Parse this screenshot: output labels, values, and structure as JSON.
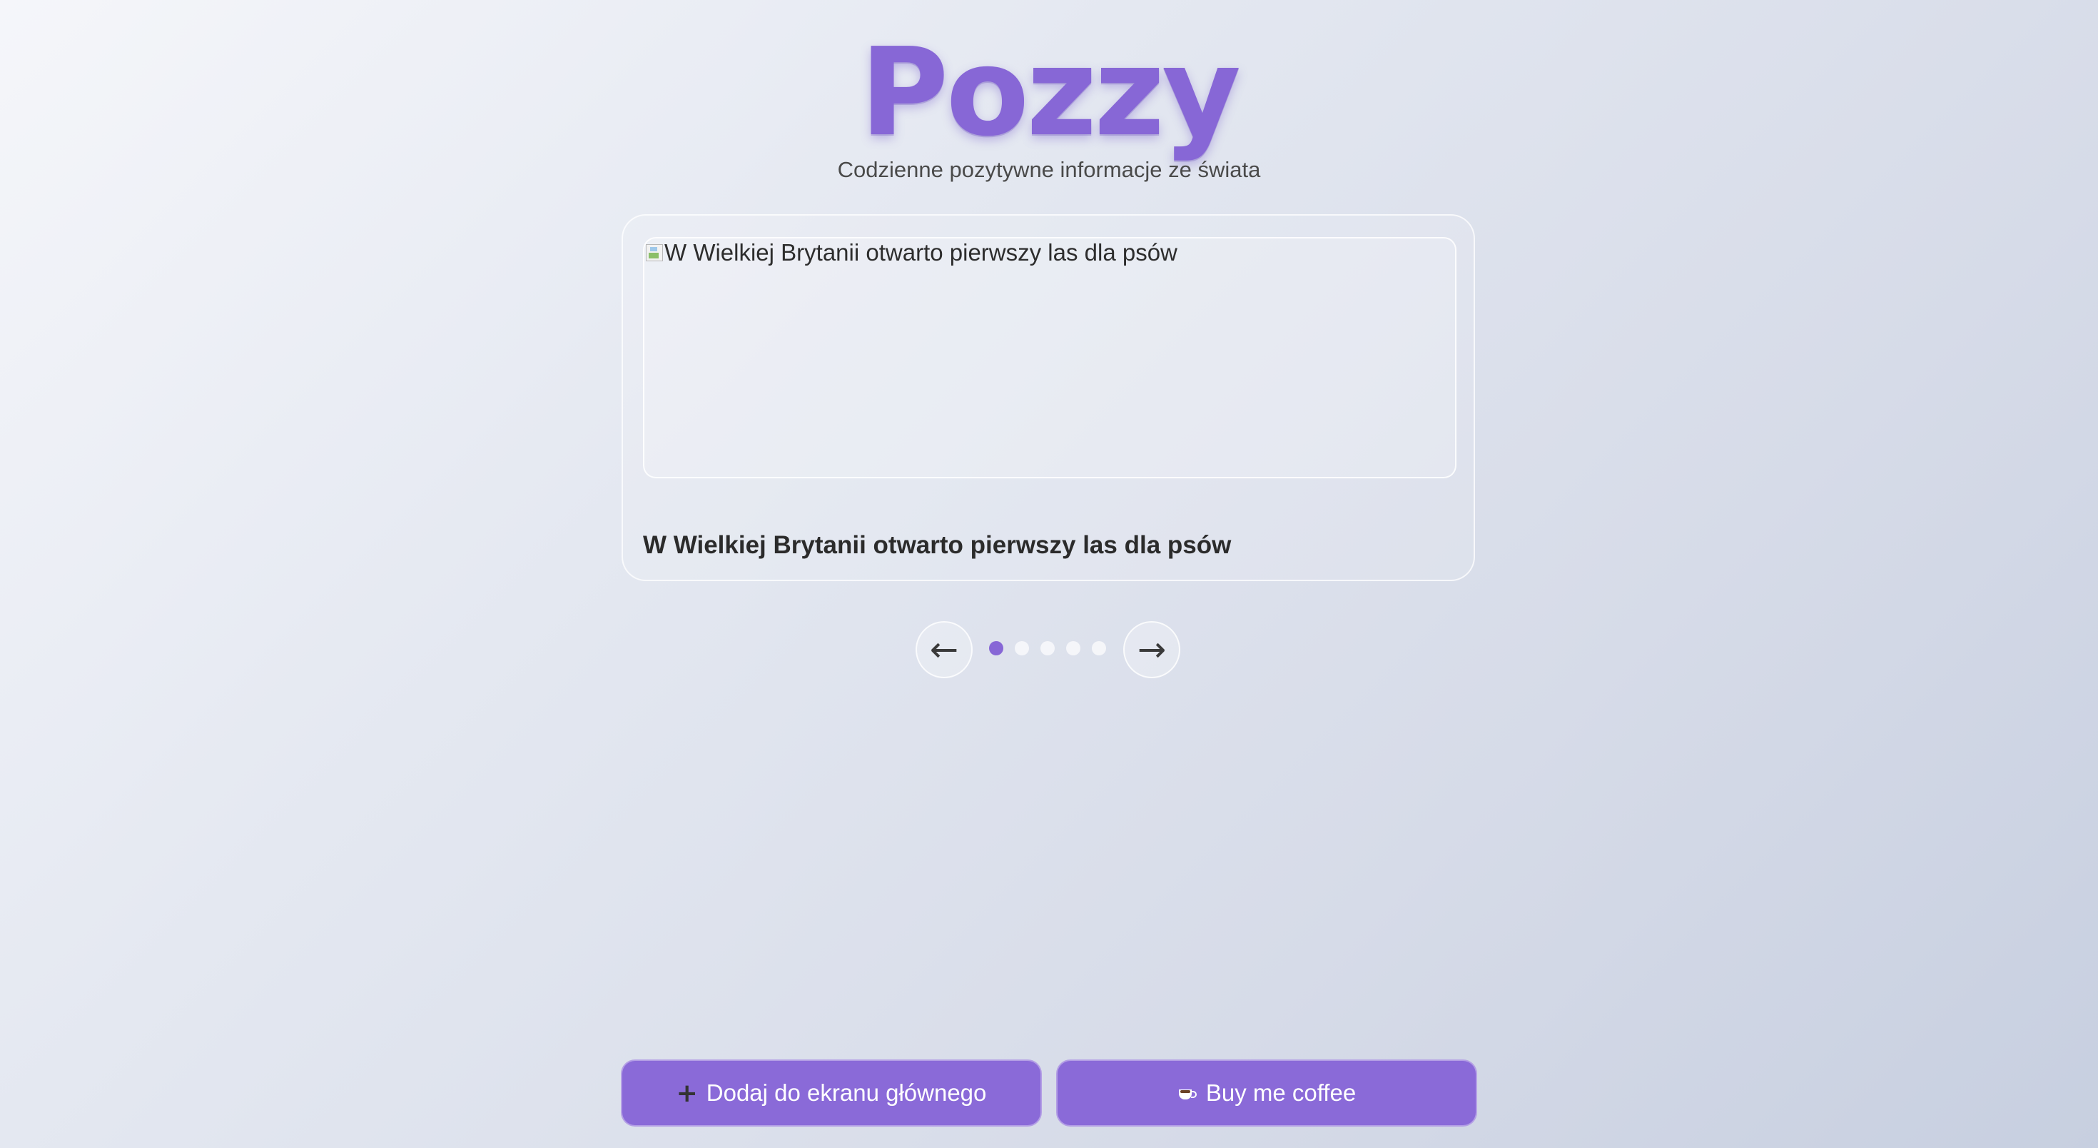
{
  "header": {
    "logo_text": "Pozzy",
    "tagline": "Codzienne pozytywne informacje ze świata"
  },
  "carousel": {
    "current_index": 1,
    "total": 5,
    "card": {
      "image_alt": "W Wielkiej Brytanii otwarto pierwszy las dla psów",
      "title": "W Wielkiej Brytanii otwarto pierwszy las dla psów"
    },
    "prev_label": "←",
    "next_label": "→"
  },
  "actions": {
    "add_home_icon": "+",
    "add_home_label": "Dodaj do ekranu głównego",
    "coffee_icon": "coffee-cup-icon",
    "coffee_label": "Buy me coffee"
  },
  "colors": {
    "accent": "#8767d6",
    "button_bg": "#8a6ad8"
  }
}
